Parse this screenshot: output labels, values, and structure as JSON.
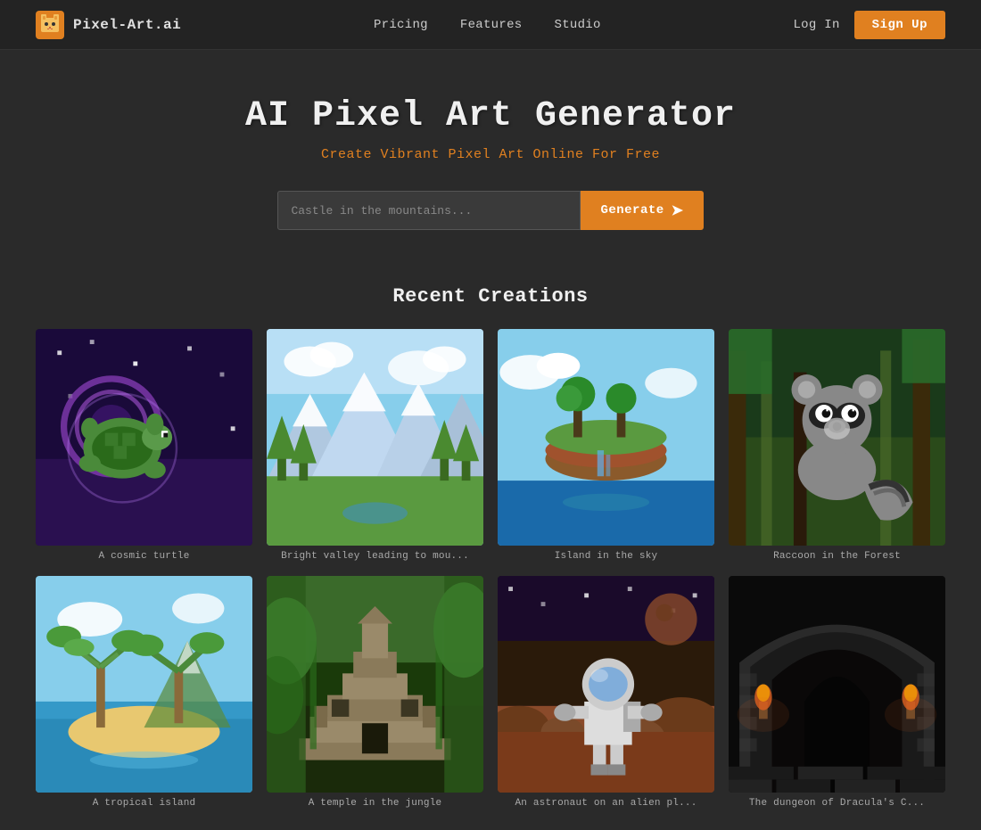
{
  "brand": {
    "logo_text": "Pixel-Art.ai",
    "logo_alt": "Pixel Art AI Logo"
  },
  "navbar": {
    "links": [
      {
        "label": "Pricing",
        "id": "pricing"
      },
      {
        "label": "Features",
        "id": "features"
      },
      {
        "label": "Studio",
        "id": "studio"
      }
    ],
    "login_label": "Log In",
    "signup_label": "Sign Up"
  },
  "hero": {
    "title": "AI Pixel Art Generator",
    "subtitle": "Create Vibrant Pixel Art Online For Free"
  },
  "search": {
    "placeholder": "Castle in the mountains...",
    "generate_label": "Generate",
    "arrow": "➤"
  },
  "recent": {
    "section_title": "Recent Creations",
    "items": [
      {
        "id": 1,
        "caption": "A cosmic turtle",
        "theme": "img-1"
      },
      {
        "id": 2,
        "caption": "Bright valley leading to mou...",
        "theme": "img-2"
      },
      {
        "id": 3,
        "caption": "Island in the sky",
        "theme": "img-3"
      },
      {
        "id": 4,
        "caption": "Raccoon in the Forest",
        "theme": "img-4"
      },
      {
        "id": 5,
        "caption": "A tropical island",
        "theme": "img-5"
      },
      {
        "id": 6,
        "caption": "A temple in the jungle",
        "theme": "img-6"
      },
      {
        "id": 7,
        "caption": "An astronaut on an alien pl...",
        "theme": "img-7"
      },
      {
        "id": 8,
        "caption": "The dungeon of Dracula's C...",
        "theme": "img-8"
      }
    ]
  },
  "colors": {
    "accent": "#e08020",
    "bg": "#2a2a2a",
    "nav_bg": "#232323"
  }
}
